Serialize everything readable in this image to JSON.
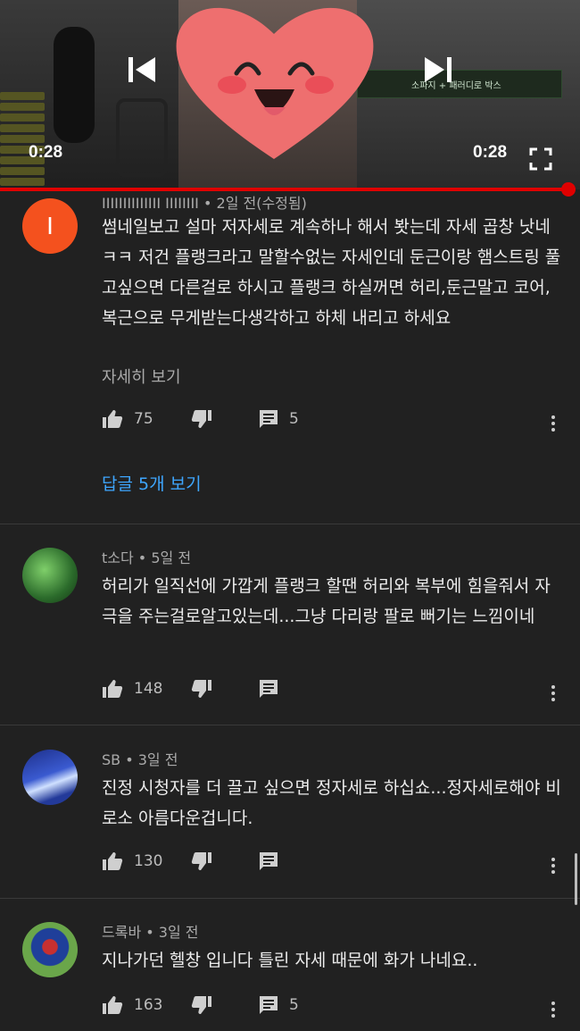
{
  "player": {
    "current_time": "0:28",
    "duration": "0:28",
    "prev_icon": "skip-previous-icon",
    "next_icon": "skip-next-icon",
    "fullscreen_icon": "fullscreen-icon",
    "overlay_text": "소파지 + 패러디로 박스",
    "progress_color": "#e00000",
    "progress": 0.98
  },
  "comments": [
    {
      "author": "IIIIIIIIIIIIII IIIIIIII",
      "age": "2일 전(수정됨)",
      "avatar_letter": "I",
      "avatar_color": "#f4511e",
      "text": "썸네일보고 설마 저자세로 계속하나 해서 봣는데 자세 곱창 낫네 ㅋㅋ 저건 플랭크라고 말할수없는 자세인데 둔근이랑 햄스트링 풀고싶으면 다른걸로 하시고 플랭크 하실꺼면 허리,둔근말고 코어, 복근으로 무게받는다생각하고 하체 내리고 하세요",
      "more_label": "자세히 보기",
      "likes": "75",
      "reply_count": "5",
      "replies_label": "답글 5개 보기"
    },
    {
      "author": "t소다",
      "age": "5일 전",
      "text": "허리가 일직선에 가깝게 플랭크 할땐 허리와 복부에 힘을줘서 자극을 주는걸로알고있는데...그냥 다리랑 팔로 뻐기는 느낌이네",
      "likes": "148"
    },
    {
      "author": "SB",
      "age": "3일 전",
      "text": "진정 시청자를 더 끌고 싶으면 정자세로 하십쇼...정자세로해야 비로소 아름다운겁니다.",
      "likes": "130"
    },
    {
      "author": "드록바",
      "age": "3일 전",
      "text": "지나가던 헬창 입니다 틀린 자세 때문에 화가 나네요..",
      "likes": "163",
      "reply_count": "5"
    }
  ],
  "icons": {
    "like": "thumb-up-icon",
    "dislike": "thumb-down-icon",
    "reply": "comment-icon",
    "menu": "more-vert-icon"
  },
  "colors": {
    "background": "#212121",
    "link": "#3ea6ff",
    "text": "#ececec",
    "meta": "#aaaaaa"
  }
}
